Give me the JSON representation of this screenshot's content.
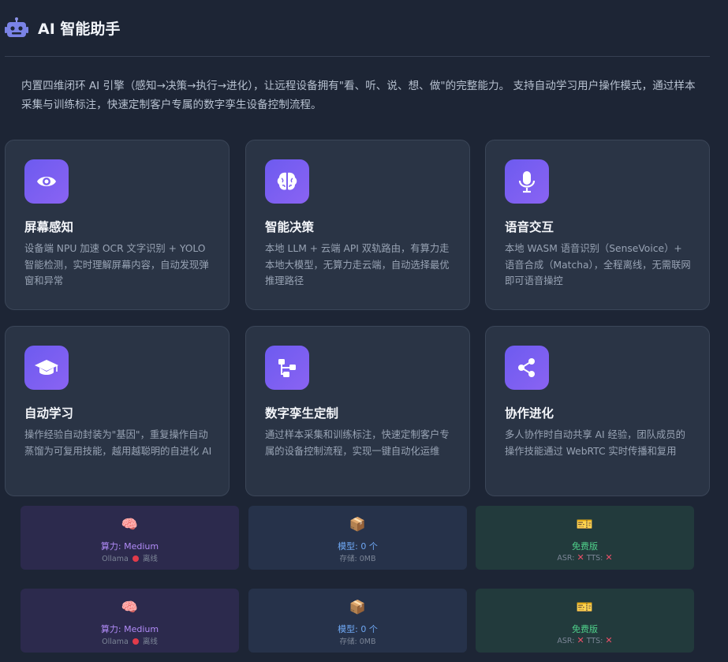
{
  "header": {
    "title": "AI 智能助手",
    "icon": "robot-icon"
  },
  "intro": "内置四维闭环 AI 引擎（感知→决策→执行→进化），让远程设备拥有\"看、听、说、想、做\"的完整能力。 支持自动学习用户操作模式，通过样本采集与训练标注，快速定制客户专属的数字孪生设备控制流程。",
  "features": [
    {
      "icon": "eye-icon",
      "title": "屏幕感知",
      "desc": "设备端 NPU 加速 OCR 文字识别 + YOLO 智能检测，实时理解屏幕内容，自动发现弹窗和异常"
    },
    {
      "icon": "brain-icon",
      "title": "智能决策",
      "desc": "本地 LLM + 云端 API 双轨路由，有算力走本地大模型，无算力走云端，自动选择最优推理路径"
    },
    {
      "icon": "microphone-icon",
      "title": "语音交互",
      "desc": "本地 WASM 语音识别（SenseVoice）+ 语音合成（Matcha），全程离线，无需联网即可语音操控"
    },
    {
      "icon": "graduation-cap-icon",
      "title": "自动学习",
      "desc": "操作经验自动封装为\"基因\"，重复操作自动蒸馏为可复用技能，越用越聪明的自进化 AI"
    },
    {
      "icon": "workflow-icon",
      "title": "数字孪生定制",
      "desc": "通过样本采集和训练标注，快速定制客户专属的设备控制流程，实现一键自动化运维"
    },
    {
      "icon": "share-icon",
      "title": "协作进化",
      "desc": "多人协作时自动共享 AI 经验，团队成员的操作技能通过 WebRTC 实时传播和复用"
    }
  ],
  "status_rows": [
    {
      "power": {
        "emoji": "🧠",
        "label": "算力: Medium",
        "sub_prefix": "Ollama",
        "sub_suffix": "离线"
      },
      "model": {
        "emoji": "📦",
        "label": "模型: 0 个",
        "sub": "存储: 0MB"
      },
      "plan": {
        "emoji": "🎫",
        "label": "免费版",
        "asr": "ASR:",
        "tts": "TTS:"
      }
    },
    {
      "power": {
        "emoji": "🧠",
        "label": "算力: Medium",
        "sub_prefix": "Ollama",
        "sub_suffix": "离线"
      },
      "model": {
        "emoji": "📦",
        "label": "模型: 0 个",
        "sub": "存储: 0MB"
      },
      "plan": {
        "emoji": "🎫",
        "label": "免费版",
        "asr": "ASR:",
        "tts": "TTS:"
      }
    }
  ],
  "colors": {
    "accent": "#7c5cf2",
    "background": "#1d2535",
    "card": "#2a3445"
  }
}
